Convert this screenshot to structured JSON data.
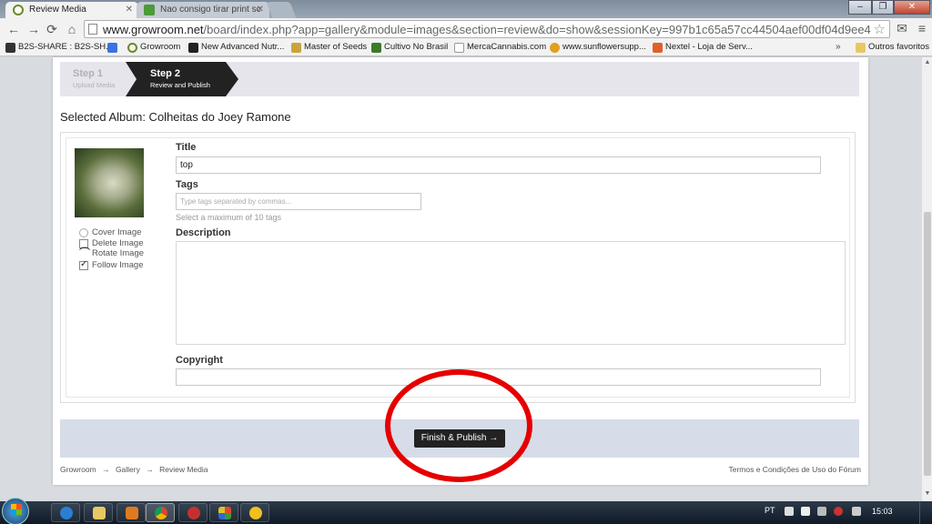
{
  "browser": {
    "tabs": [
      {
        "title": "Review Media",
        "active": true
      },
      {
        "title": "Nao consigo tirar print sc",
        "active": false
      }
    ],
    "url": {
      "host": "www.growroom.net",
      "path": "/board/index.php?app=gallery&module=images&section=review&do=show&sessionKey=997b1c65a57cc44504aef00df04d9ee4"
    },
    "bookmarks": [
      "B2S-SHARE : B2S-SH...",
      "",
      "Growroom",
      "New Advanced Nutr...",
      "Master of Seeds",
      "Cultivo No Brasil",
      "MercaCannabis.com",
      "www.sunflowersupp...",
      "Nextel - Loja de Serv..."
    ],
    "bookmarks_more": "»",
    "other_bookmarks": "Outros favoritos"
  },
  "steps": [
    {
      "title": "Step 1",
      "subtitle": "Upload Media",
      "active": false
    },
    {
      "title": "Step 2",
      "subtitle": "Review and Publish",
      "active": true
    }
  ],
  "album_title": "Selected Album: Colheitas do Joey Ramone",
  "image_options": {
    "cover": "Cover Image",
    "delete": "Delete Image",
    "rotate": "Rotate Image",
    "follow": "Follow Image"
  },
  "form": {
    "title_label": "Title",
    "title_value": "top",
    "tags_label": "Tags",
    "tags_placeholder": "Type tags separated by commas...",
    "tags_hint": "Select a maximum of 10 tags",
    "description_label": "Description",
    "copyright_label": "Copyright"
  },
  "finish_button": "Finish & Publish →",
  "breadcrumb": [
    "Growroom",
    "→",
    "Gallery",
    "→",
    "Review Media"
  ],
  "terms": "Termos e Condições de Uso do Fórum",
  "taskbar": {
    "language": "PT",
    "time": "15:03"
  },
  "colors": {
    "annotation_circle": "#e50000",
    "step_active": "#222222",
    "button": "#222222"
  }
}
